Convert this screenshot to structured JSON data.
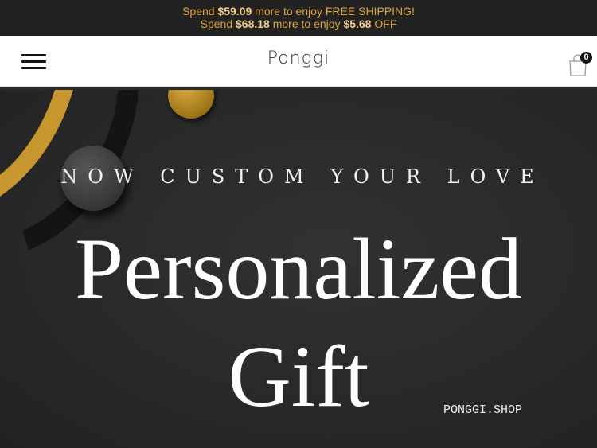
{
  "announcement": {
    "line1": {
      "pre": "Spend ",
      "amount": "$59.09",
      "post": " more to enjoy FREE SHIPPING!"
    },
    "line2": {
      "pre": "Spend ",
      "amount": "$68.18",
      "mid": " more to enjoy ",
      "discount": "$5.68",
      "post": " OFF"
    }
  },
  "header": {
    "logo": "Ponggi",
    "cart_count": "0",
    "icons": {
      "menu": "hamburger-menu-icon",
      "cart": "shopping-bag-icon"
    }
  },
  "hero": {
    "tagline": "NOW CUSTOM YOUR LOVE",
    "title_line1": "Personalized",
    "title_line2": "Gift",
    "site": "PONGGI.SHOP"
  },
  "colors": {
    "announcement_bg": "#222222",
    "announcement_text": "#e0a43a",
    "hero_bg": "#2a2a2a",
    "accent_gold": "#c8962e"
  }
}
